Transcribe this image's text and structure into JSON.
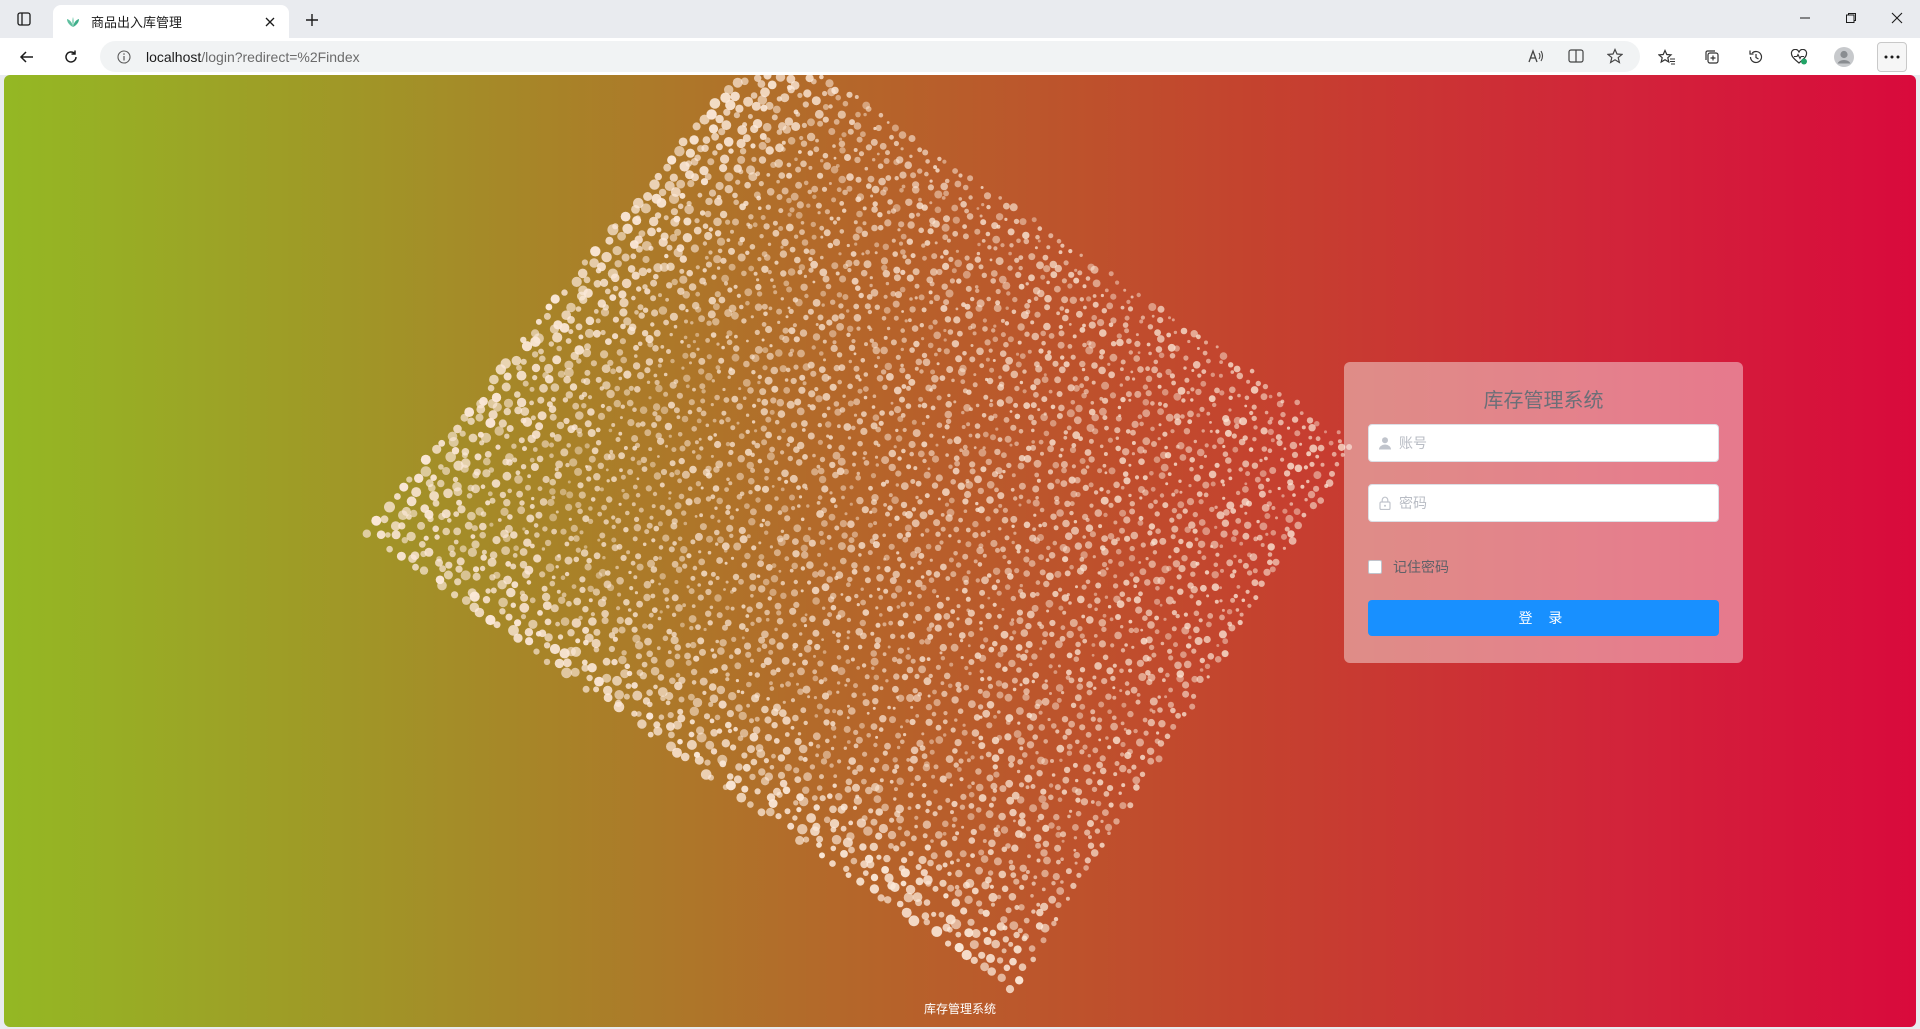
{
  "browser": {
    "tab_title": "商品出入库管理",
    "new_tab_label": "+",
    "url_host": "localhost",
    "url_path": "/login?redirect=%2Findex"
  },
  "page": {
    "background_colors": [
      "#94b824",
      "#c4432e",
      "#d90a3c"
    ],
    "particle_color": "#fbe8d8"
  },
  "login": {
    "title": "库存管理系统",
    "username_placeholder": "账号",
    "password_placeholder": "密码",
    "remember_label": "记住密码",
    "remember_checked": false,
    "submit_label": "登 录"
  },
  "footer": {
    "text": "库存管理系统"
  },
  "icons": {
    "tab_favicon": "leaf-icon",
    "username": "user-icon",
    "password": "lock-icon"
  }
}
